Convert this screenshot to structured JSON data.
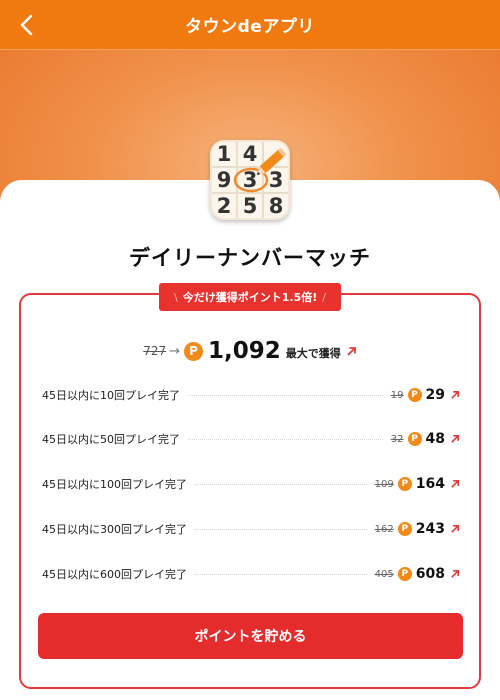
{
  "header": {
    "title": "タウンdeアプリ",
    "back_icon": "chevron-left-icon"
  },
  "app": {
    "name": "デイリーナンバーマッチ",
    "icon_digits": [
      "1",
      "4",
      "",
      "9",
      "3",
      "3",
      "2",
      "5",
      "8"
    ]
  },
  "promo": {
    "text": "今だけ獲得ポイント1.5倍!"
  },
  "summary": {
    "old_points": "727",
    "coin_letter": "P",
    "points": "1,092",
    "suffix": "最大で獲得"
  },
  "missions": [
    {
      "label": "45日以内に10回プレイ完了",
      "old": "19",
      "new": "29"
    },
    {
      "label": "45日以内に50回プレイ完了",
      "old": "32",
      "new": "48"
    },
    {
      "label": "45日以内に100回プレイ完了",
      "old": "109",
      "new": "164"
    },
    {
      "label": "45日以内に300回プレイ完了",
      "old": "162",
      "new": "243"
    },
    {
      "label": "45日以内に600回プレイ完了",
      "old": "405",
      "new": "608"
    }
  ],
  "cta": {
    "label": "ポイントを貯める"
  },
  "colors": {
    "header": "#f07a10",
    "accent_red": "#e52c2c",
    "coin": "#f28a1a"
  }
}
